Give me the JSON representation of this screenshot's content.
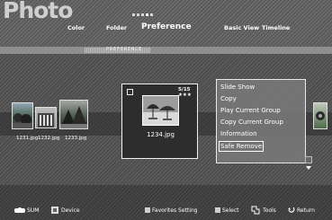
{
  "app": {
    "title": "Photo"
  },
  "menu": {
    "items": [
      {
        "label": "Color"
      },
      {
        "label": "Folder"
      },
      {
        "label": "Preference"
      },
      {
        "label": "Basic View"
      },
      {
        "label": "Timeline"
      }
    ]
  },
  "sort_bar": {
    "label": "PREFERENCE"
  },
  "thumbnails": [
    {
      "label": "1231.jpg"
    },
    {
      "label": "1232.jpg"
    },
    {
      "label": "1233.jpg"
    }
  ],
  "featured": {
    "label": "1234.jpg",
    "position": "5/15",
    "rating": "★★★"
  },
  "context_menu": {
    "items": [
      {
        "label": "Slide Show"
      },
      {
        "label": "Copy"
      },
      {
        "label": "Play Current Group"
      },
      {
        "label": "Copy Current Group"
      },
      {
        "label": "Information"
      },
      {
        "label": "Safe Remove"
      }
    ],
    "selected_index": 5
  },
  "footer": {
    "sum_label": "SUM",
    "device_label": "Device",
    "favorites_label": "Favorites Setting",
    "select_label": "Select",
    "tools_label": "Tools",
    "return_label": "Return"
  }
}
